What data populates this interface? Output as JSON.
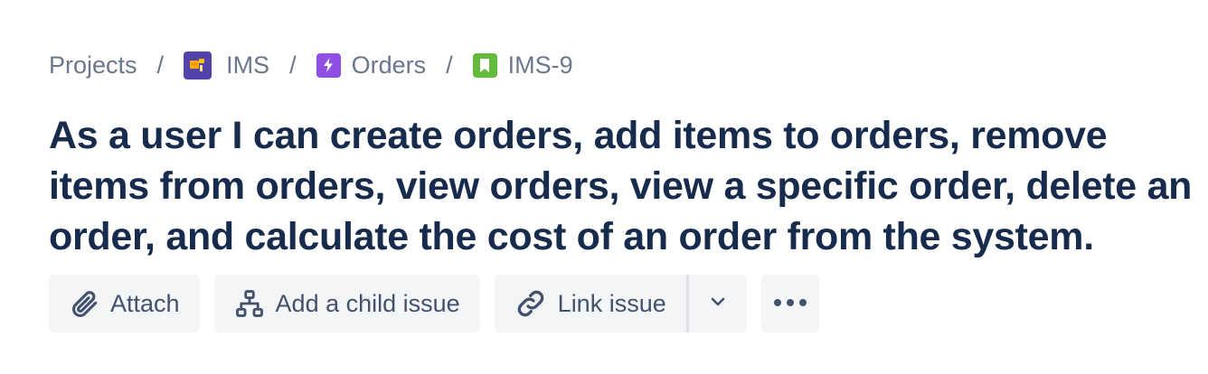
{
  "breadcrumb": {
    "items": [
      {
        "label": "Projects",
        "icon": ""
      },
      {
        "label": "IMS",
        "icon": "project-avatar-icon",
        "color": "#5243aa"
      },
      {
        "label": "Orders",
        "icon": "epic-lightning-icon",
        "color": "#904ee2"
      },
      {
        "label": "IMS-9",
        "icon": "story-bookmark-icon",
        "color": "#63ba3c"
      }
    ],
    "separator": "/"
  },
  "issue": {
    "title": "As a user I can create orders, add items to orders, remove items from orders, view orders, view a specific order, delete an order, and calculate the cost of an order from the system."
  },
  "actions": {
    "attach_label": "Attach",
    "attach_icon": "paperclip-icon",
    "child_issue_label": "Add a child issue",
    "child_issue_icon": "hierarchy-icon",
    "link_issue_label": "Link issue",
    "link_issue_icon": "link-icon",
    "link_dropdown_icon": "chevron-down-icon",
    "more_icon": "more-horizontal-icon"
  },
  "colors": {
    "title": "#172b4d",
    "muted": "#6b778c",
    "button_bg": "#f4f5f7",
    "button_text": "#42526e"
  }
}
